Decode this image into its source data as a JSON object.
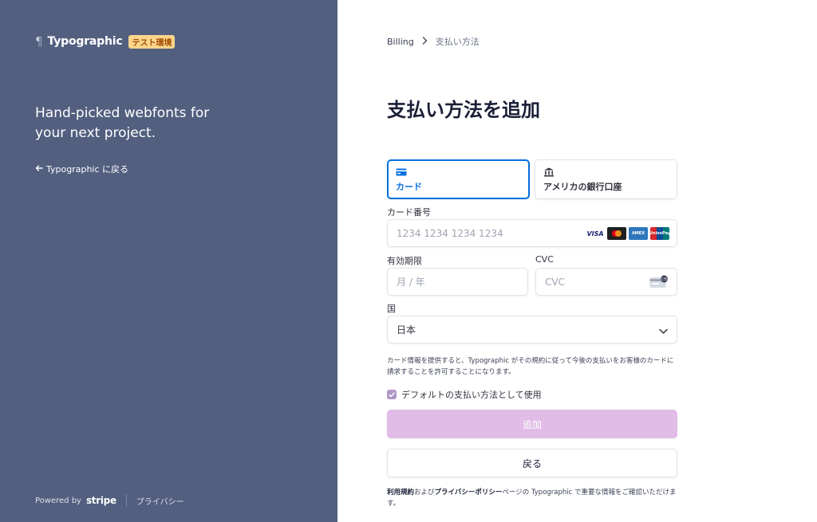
{
  "left": {
    "brand_name": "Typographic",
    "test_badge": "テスト環境",
    "tagline": "Hand-picked webfonts for your next project.",
    "back_link": "Typographic に戻る",
    "footer_powered": "Powered by",
    "footer_stripe": "stripe",
    "footer_privacy": "プライバシー",
    "background_color": "#525f7f"
  },
  "right": {
    "breadcrumb": {
      "root": "Billing",
      "current": "支払い方法"
    },
    "title": "支払い方法を追加",
    "tabs": [
      {
        "label": "カード",
        "icon": "card-icon",
        "active": true
      },
      {
        "label": "アメリカの銀行口座",
        "icon": "bank-icon",
        "active": false
      }
    ],
    "card_number": {
      "label": "カード番号",
      "placeholder": "1234 1234 1234 1234",
      "brands": [
        "VISA",
        "mastercard",
        "AMEX",
        "UnionPay"
      ]
    },
    "expiry": {
      "label": "有効期限",
      "placeholder": "月 / 年"
    },
    "cvc": {
      "label": "CVC",
      "placeholder": "CVC",
      "cvc_hint": "135"
    },
    "country": {
      "label": "国",
      "value": "日本"
    },
    "legal_text": "カード情報を提供すると、Typographic がその規約に従って今後の支払いをお客様のカードに請求することを許可することになります。",
    "default_checkbox": {
      "label": "デフォルトの支払い方法として使用",
      "checked": true
    },
    "add_button": "追加",
    "back_button": "戻る",
    "terms": {
      "link1": "利用規約",
      "and": "および",
      "link2": "プライバシーポリシー",
      "rest": "ページの Typographic で重要な情報をご確認いただけます。"
    },
    "accent_color": "#0570de",
    "add_button_color": "#e1bce7"
  }
}
